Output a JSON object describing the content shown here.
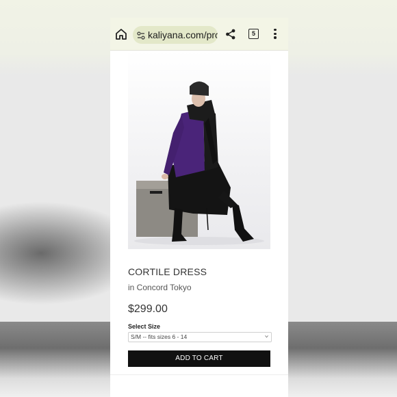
{
  "browser": {
    "url": "kaliyana.com/prc",
    "tab_count": "5"
  },
  "icons": {
    "home": "home-icon",
    "site_settings": "tune-icon",
    "share": "share-icon",
    "tabs": "tab-switcher-icon",
    "menu": "more-vert-icon"
  },
  "product": {
    "title": "CORTILE DRESS",
    "collection": "in Concord Tokyo",
    "price": "$299.00",
    "size_label": "Select Size",
    "size_selected": "S/M -- fits sizes 6 - 14",
    "add_to_cart": "ADD TO CART"
  },
  "colors": {
    "button_bg": "#111111",
    "browser_bar": "#f3f5e6",
    "url_pill": "#e3e8c9",
    "dress_purple": "#4a2479"
  }
}
